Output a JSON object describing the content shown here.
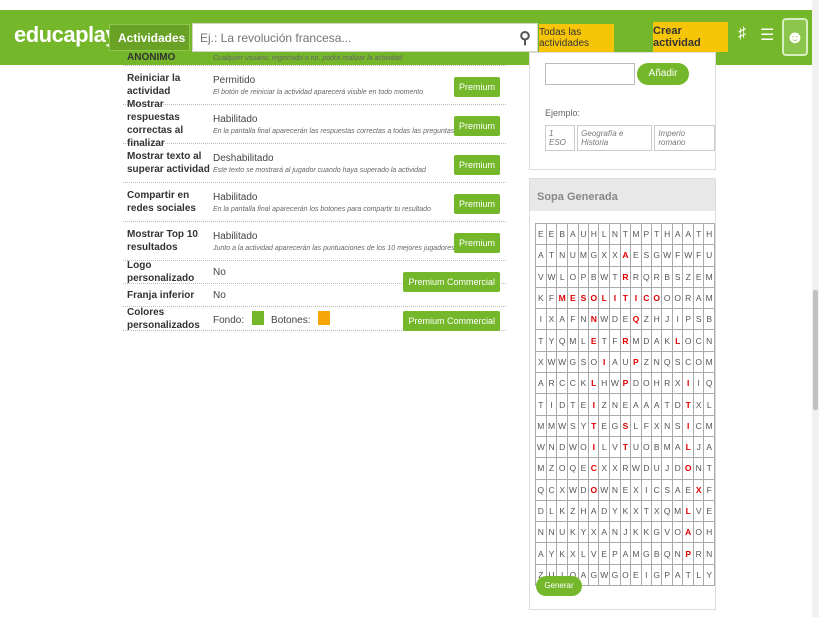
{
  "header": {
    "logo": "educaplay",
    "activities_label": "Actividades",
    "search_placeholder": "Ej.: La revolución francesa...",
    "all_activities_label": "Todas las actividades",
    "create_label": "Crear actividad"
  },
  "settings": {
    "top_label": "ANÓNIMO",
    "top_desc": "Cualquier usuario, registrado o no, podrá realizar la actividad",
    "rows": [
      {
        "label": "Reiniciar la actividad",
        "value": "Permitido",
        "desc": "El botón de reiniciar la actividad aparecerá visible en todo momento",
        "button": "Premium"
      },
      {
        "label": "Mostrar respuestas correctas al finalizar",
        "value": "Habilitado",
        "desc": "En la pantalla final aparecerán las respuestas correctas a todas las preguntas",
        "button": "Premium"
      },
      {
        "label": "Mostrar texto al superar actividad",
        "value": "Deshabilitado",
        "desc": "Este texto se mostrará al jugador cuando haya superado la actividad",
        "button": "Premium"
      },
      {
        "label": "Compartir en redes sociales",
        "value": "Habilitado",
        "desc": "En la pantalla final aparecerán los botones para compartir tu resultado",
        "button": "Premium"
      },
      {
        "label": "Mostrar Top 10 resultados",
        "value": "Habilitado",
        "desc": "Junto a la actividad aparecerán las puntuaciones de los 10 mejores jugadores",
        "button": "Premium"
      }
    ],
    "logo_label": "Logo personalizado",
    "logo_value": "No",
    "franja_label": "Franja inferior",
    "franja_value": "No",
    "commercial_button": "Premium Commercial",
    "colors_label": "Colores personalizados",
    "fondo_label": "Fondo:",
    "botones_label": "Botones:",
    "fondo_color": "#75b72a",
    "botones_color": "#f7a60a",
    "colors_button": "Premium Commercial"
  },
  "tags": {
    "add_label": "Añadir",
    "example_label": "Ejemplo:",
    "examples": [
      "1 ESO",
      "Geografía e Historia",
      "Imperio romano"
    ]
  },
  "sopa": {
    "title": "Sopa Generada",
    "generate_label": "Generar Otra",
    "grid": [
      "EEBAUHLNTMPTHAATH",
      "ATNUMGXXAESGWFWFU",
      "VWLOPBWTRRQRBSZEM",
      "KFMESOLITICOOORAM",
      "IXAFNNWDEQZHJIPSB",
      "TYQMLETFRMDAKLOCN",
      "XWWGSOIAUPZNQSCOM",
      "ARCCKLHWPDOHRXIIQ",
      "TIDTEIZNEAAATDTXL",
      "MMWSYTEGSLFXNSICM",
      "WNDWOILVTUOBMALJA",
      "MZOQECXXRWDUJDONT",
      "QCXWDOWNEXICSAEXF",
      "DLKZHADYKXTXQMLVE",
      "NNUKYXANJKKGVOAOH",
      "AYKXLVEPAMGBQNPRN",
      "ZUIQAGWGOEIGPATLY"
    ],
    "highlights": [
      [
        1,
        8
      ],
      [
        2,
        8
      ],
      [
        3,
        2
      ],
      [
        3,
        3
      ],
      [
        3,
        4
      ],
      [
        3,
        5
      ],
      [
        3,
        6
      ],
      [
        3,
        7
      ],
      [
        3,
        8
      ],
      [
        3,
        9
      ],
      [
        3,
        10
      ],
      [
        3,
        11
      ],
      [
        4,
        5
      ],
      [
        4,
        9
      ],
      [
        5,
        5
      ],
      [
        5,
        8
      ],
      [
        5,
        13
      ],
      [
        6,
        6
      ],
      [
        6,
        9
      ],
      [
        7,
        5
      ],
      [
        7,
        8
      ],
      [
        7,
        14
      ],
      [
        8,
        5
      ],
      [
        8,
        14
      ],
      [
        9,
        5
      ],
      [
        9,
        8
      ],
      [
        9,
        14
      ],
      [
        10,
        5
      ],
      [
        10,
        8
      ],
      [
        10,
        14
      ],
      [
        11,
        5
      ],
      [
        11,
        14
      ],
      [
        12,
        5
      ],
      [
        12,
        15
      ],
      [
        13,
        14
      ],
      [
        14,
        14
      ],
      [
        15,
        14
      ]
    ]
  }
}
